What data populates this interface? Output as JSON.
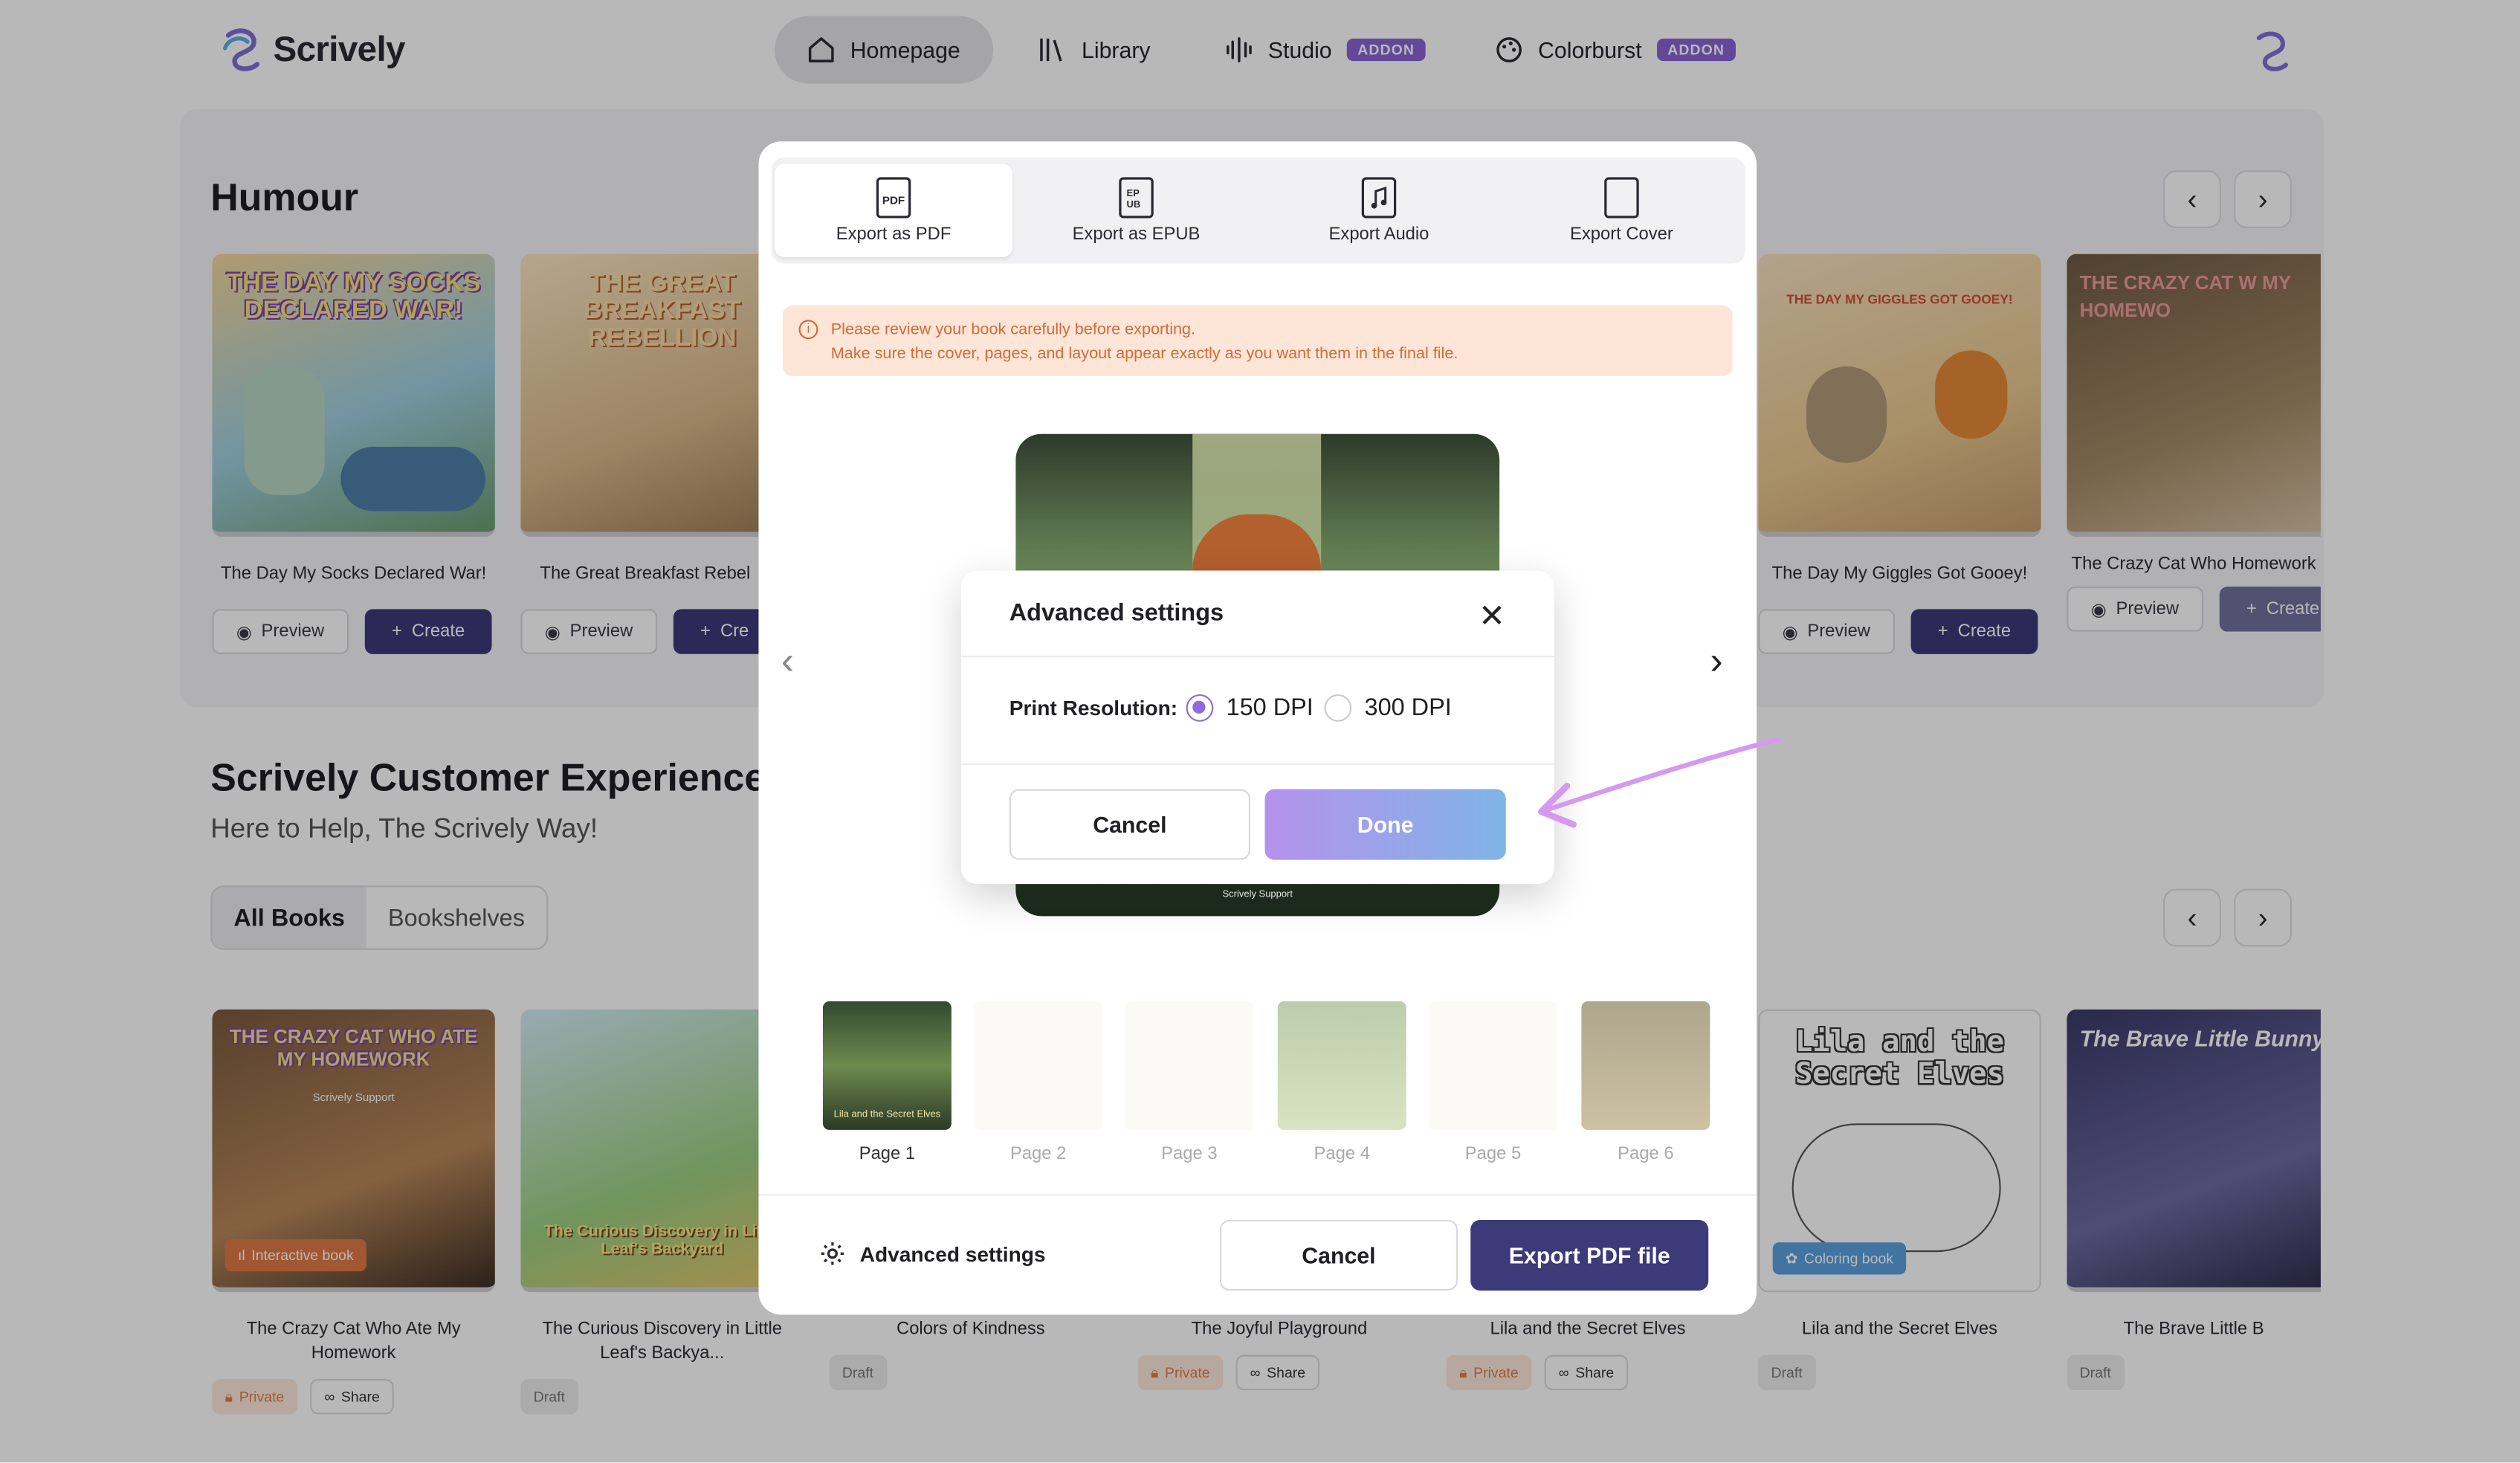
{
  "app": {
    "name": "Scrively"
  },
  "nav": {
    "items": [
      {
        "label": "Homepage",
        "icon": "home-icon",
        "active": true
      },
      {
        "label": "Library",
        "icon": "library-icon"
      },
      {
        "label": "Studio",
        "icon": "waveform-icon",
        "badge": "ADDON"
      },
      {
        "label": "Colorburst",
        "icon": "palette-icon",
        "badge": "ADDON"
      }
    ]
  },
  "humour": {
    "title": "Humour",
    "cards": [
      {
        "cover_text": "THE DAY MY SOCKS DECLARED WAR!",
        "title": "The Day My Socks Declared War!",
        "preview": "Preview",
        "create": "Create"
      },
      {
        "cover_text": "THE GREAT BREAKFAST REBELLION",
        "title": "The Great Breakfast Rebel",
        "preview": "Preview",
        "create": "Cre"
      },
      {
        "cover_text": "THE DAY MY GIGGLES GOT GOOEY!",
        "title": "The Day My Giggles Got Gooey!",
        "preview": "Preview",
        "create": "Create"
      },
      {
        "cover_text": "THE CRAZY CAT W MY HOMEWO",
        "title": "The Crazy Cat Who Homework",
        "preview": "Preview",
        "create": "Create"
      }
    ]
  },
  "team": {
    "title": "Scrively Customer Experience Te",
    "subtitle": "Here to Help, The Scrively Way!",
    "tabs": [
      "All Books",
      "Bookshelves"
    ]
  },
  "books": [
    {
      "cover_text": "THE CRAZY CAT WHO ATE MY HOMEWORK",
      "cover_sub": "Scrively Support",
      "badge": "Interactive book",
      "title": "The Crazy Cat Who Ate My Homework",
      "tags": [
        "Private",
        "Share"
      ]
    },
    {
      "cover_text": "The Curious Discovery in Little Leaf's Backyard",
      "title": "The Curious Discovery in Little Leaf's Backya...",
      "tags": [
        "Draft"
      ]
    },
    {
      "title": "Colors of Kindness",
      "tags": [
        "Draft"
      ]
    },
    {
      "title": "The Joyful Playground",
      "tags": [
        "Private",
        "Share"
      ]
    },
    {
      "title": "Lila and the Secret Elves",
      "tags": [
        "Private",
        "Share"
      ]
    },
    {
      "cover_text": "Lila and the Secret Elves",
      "badge": "Coloring book",
      "title": "Lila and the Secret Elves",
      "tags": [
        "Draft"
      ]
    },
    {
      "cover_text": "The Brave Little Bunny",
      "title": "The Brave Little B",
      "tags": [
        "Draft"
      ]
    }
  ],
  "export_modal": {
    "tabs": [
      {
        "label": "Export as PDF",
        "icon": "pdf-file-icon",
        "active": true
      },
      {
        "label": "Export as EPUB",
        "icon": "epub-file-icon"
      },
      {
        "label": "Export Audio",
        "icon": "audio-file-icon"
      },
      {
        "label": "Export Cover",
        "icon": "cover-file-icon"
      }
    ],
    "notice_line1": "Please review your book carefully before exporting.",
    "notice_line2": "Make sure the cover, pages, and layout appear exactly as you want them in the final file.",
    "preview_caption": "Scrively Support",
    "pages": [
      "Page 1",
      "Page 2",
      "Page 3",
      "Page 4",
      "Page 5",
      "Page 6"
    ],
    "page1_text": "Lila and the Secret Elves",
    "advanced_label": "Advanced settings",
    "cancel_label": "Cancel",
    "export_label": "Export PDF file"
  },
  "advanced_modal": {
    "title": "Advanced settings",
    "field_label": "Print Resolution:",
    "options": [
      {
        "label": "150 DPI",
        "selected": true
      },
      {
        "label": "300 DPI",
        "selected": false
      }
    ],
    "cancel_label": "Cancel",
    "done_label": "Done"
  },
  "colors": {
    "accent": "#3d3a7a",
    "badge": "#8a64d6",
    "done_gradient_start": "#b592ec",
    "done_gradient_end": "#7fb4e6",
    "notice_bg": "#fde6d7",
    "notice_text": "#d16b3a",
    "annotation_arrow": "#d59af0"
  }
}
